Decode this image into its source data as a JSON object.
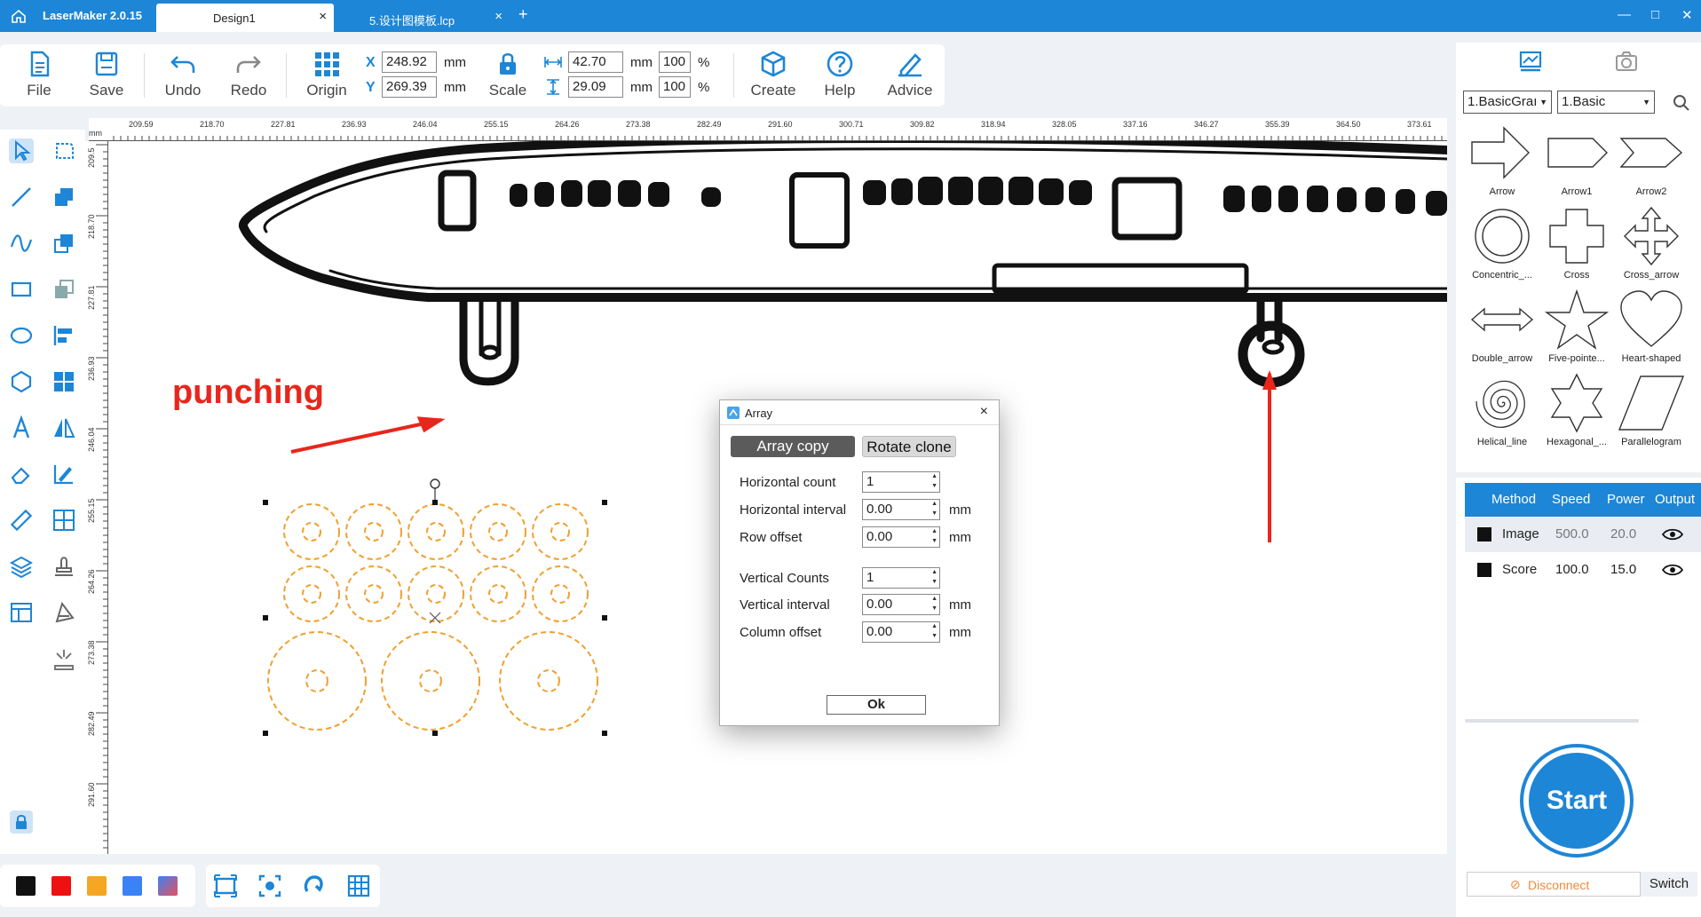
{
  "titlebar": {
    "app_name": "LaserMaker 2.0.15",
    "tabs": [
      {
        "label": "Design1",
        "active": true
      },
      {
        "label": "5.设计图模板.lcp",
        "active": false
      }
    ],
    "add_tab": "+",
    "close_glyph": "×"
  },
  "toolbar": {
    "file": "File",
    "save": "Save",
    "undo": "Undo",
    "redo": "Redo",
    "origin": "Origin",
    "scale": "Scale",
    "create": "Create",
    "help": "Help",
    "advice": "Advice",
    "x_label": "X",
    "x_value": "248.92",
    "y_label": "Y",
    "y_value": "269.39",
    "unit": "mm",
    "width_value": "42.70",
    "height_value": "29.09",
    "width_pct": "100",
    "height_pct": "100",
    "pct": "%"
  },
  "ruler": {
    "unit_label": "mm",
    "h_ticks": [
      "209.59",
      "218.70",
      "227.81",
      "236.93",
      "246.04",
      "255.15",
      "264.26",
      "273.38",
      "282.49",
      "291.60",
      "300.71",
      "309.82",
      "318.94",
      "328.05",
      "337.16",
      "346.27",
      "355.39",
      "364.50",
      "373.61"
    ],
    "v_ticks": [
      "209.5",
      "218.70",
      "227.81",
      "236.93",
      "246.04",
      "255.15",
      "264.26",
      "273.38",
      "282.49",
      "291.60"
    ]
  },
  "canvas": {
    "annotation": "punching"
  },
  "dialog": {
    "title": "Array",
    "tab_array_copy": "Array copy",
    "tab_rotate_clone": "Rotate clone",
    "fields": [
      {
        "label": "Horizontal count",
        "value": "1",
        "unit": ""
      },
      {
        "label": "Horizontal interval",
        "value": "0.00",
        "unit": "mm"
      },
      {
        "label": "Row offset",
        "value": "0.00",
        "unit": "mm"
      },
      {
        "label": "Vertical Counts",
        "value": "1",
        "unit": ""
      },
      {
        "label": "Vertical interval",
        "value": "0.00",
        "unit": "mm"
      },
      {
        "label": "Column offset",
        "value": "0.00",
        "unit": "mm"
      }
    ],
    "ok": "Ok"
  },
  "right_panel": {
    "category_select": "1.BasicGraı",
    "sub_select": "1.Basic",
    "shapes": [
      {
        "name": "Arrow"
      },
      {
        "name": "Arrow1"
      },
      {
        "name": "Arrow2"
      },
      {
        "name": "Concentric_..."
      },
      {
        "name": "Cross"
      },
      {
        "name": "Cross_arrow"
      },
      {
        "name": "Double_arrow"
      },
      {
        "name": "Five-pointe..."
      },
      {
        "name": "Heart-shaped"
      },
      {
        "name": "Helical_line"
      },
      {
        "name": "Hexagonal_..."
      },
      {
        "name": "Parallelogram"
      }
    ],
    "layers": {
      "headers": [
        "Method",
        "Speed",
        "Power",
        "Output"
      ],
      "rows": [
        {
          "method": "Image",
          "speed": "500.0",
          "power": "20.0"
        },
        {
          "method": "Score",
          "speed": "100.0",
          "power": "15.0"
        }
      ]
    },
    "start": "Start",
    "disconnect": "Disconnect",
    "switch": "Switch"
  },
  "colors": {
    "accent": "#1d86d6",
    "swatches": [
      "#111111",
      "#ee1111",
      "#f5a623",
      "#3b82f6",
      "#e8505b"
    ],
    "design_orange": "#f0a030"
  }
}
